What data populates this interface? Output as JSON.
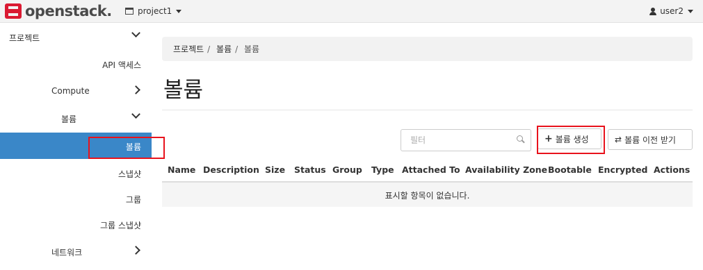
{
  "brand": {
    "name": "openstack",
    "mark": "."
  },
  "header": {
    "project": "project1",
    "user": "user2"
  },
  "sidebar": {
    "items": [
      {
        "label": "프로젝트"
      },
      {
        "label": "API 액세스"
      },
      {
        "label": "Compute"
      },
      {
        "label": "볼륨"
      },
      {
        "label": "볼륨"
      },
      {
        "label": "스냅샷"
      },
      {
        "label": "그룹"
      },
      {
        "label": "그룹 스냅샷"
      },
      {
        "label": "네트워크"
      }
    ]
  },
  "breadcrumb": {
    "items": [
      "프로젝트",
      "볼륨",
      "볼륨"
    ]
  },
  "page": {
    "title": "볼륨"
  },
  "toolbar": {
    "filter_placeholder": "필터",
    "create_label": "볼륨 생성",
    "transfer_label": "볼륨 이전 받기"
  },
  "table": {
    "columns": [
      "Name",
      "Description",
      "Size",
      "Status",
      "Group",
      "Type",
      "Attached To",
      "Availability Zone",
      "Bootable",
      "Encrypted",
      "Actions"
    ],
    "empty_message": "표시할 항목이 없습니다."
  },
  "colors": {
    "active": "#3a87c8",
    "highlight": "#e8121c",
    "brand_red": "#da1a32"
  }
}
